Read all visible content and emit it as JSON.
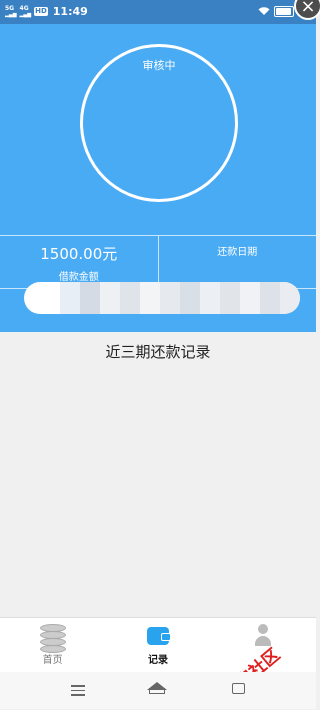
{
  "status_bar": {
    "signal_5g": "5G",
    "signal_4g": "4G",
    "hd": "HD",
    "time": "11:49",
    "wifi_icon": "wifi-icon",
    "battery_icon": "battery-icon",
    "battery_level": 0.85
  },
  "close_icon": "close-icon",
  "hero": {
    "status_text": "审核中",
    "loan_amount": "1500.00元",
    "loan_amount_label": "借款金额",
    "repay_date_label": "还款日期"
  },
  "records": {
    "title": "近三期还款记录"
  },
  "tabs": [
    {
      "label": "首页",
      "icon": "coins-icon",
      "active": false
    },
    {
      "label": "记录",
      "icon": "wallet-icon",
      "active": true
    },
    {
      "label": "",
      "icon": "person-icon",
      "active": false
    }
  ],
  "watermark": {
    "text": "卡农社区"
  },
  "colors": {
    "hero_bg": "#4aabf5",
    "status_bar_bg": "#3a81c3",
    "page_bg": "#f0f0f0",
    "accent": "#2aa3ef",
    "watermark": "#e02020"
  }
}
